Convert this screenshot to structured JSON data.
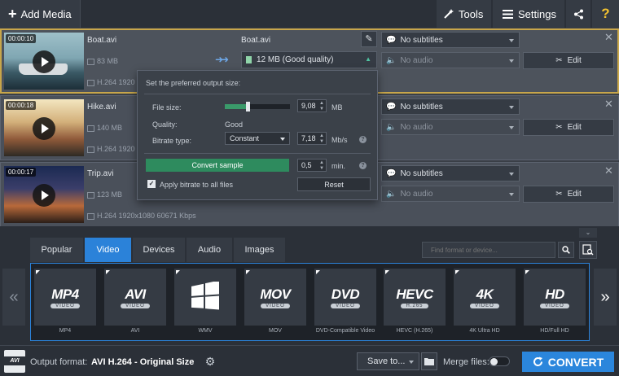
{
  "header": {
    "add_media": "Add Media",
    "tools": "Tools",
    "settings": "Settings"
  },
  "files": [
    {
      "duration": "00:00:10",
      "name": "Boat.avi",
      "output_name": "Boat.avi",
      "size": "83 MB",
      "output_size": "12 MB (Good quality)",
      "codec": "H.264 1920",
      "subtitles": "No subtitles",
      "audio": "No audio",
      "edit": "Edit"
    },
    {
      "duration": "00:00:18",
      "name": "Hike.avi",
      "size": "140 MB",
      "codec": "H.264 1920",
      "subtitles": "No subtitles",
      "audio": "No audio",
      "edit": "Edit"
    },
    {
      "duration": "00:00:17",
      "name": "Trip.avi",
      "size": "123 MB",
      "codec": "H.264 1920x1080 60671 Kbps",
      "subtitles": "No subtitles",
      "audio": "No audio",
      "edit": "Edit"
    }
  ],
  "popup": {
    "heading": "Set the preferred output size:",
    "file_size_label": "File size:",
    "file_size_value": "9,08",
    "file_size_unit": "MB",
    "file_size_fraction": 0.35,
    "quality_label": "Quality:",
    "quality_value": "Good",
    "bitrate_label": "Bitrate type:",
    "bitrate_type": "Constant",
    "bitrate_value": "7,18",
    "bitrate_unit": "Mb/s",
    "convert_sample": "Convert sample",
    "sample_value": "0,5",
    "sample_unit": "min.",
    "apply_all": "Apply bitrate to all files",
    "reset": "Reset"
  },
  "tabs": [
    "Popular",
    "Video",
    "Devices",
    "Audio",
    "Images"
  ],
  "active_tab": "Video",
  "search_placeholder": "Find format or device...",
  "formats": [
    {
      "logo": "MP4",
      "sub": "VIDEO",
      "label": "MP4"
    },
    {
      "logo": "AVI",
      "sub": "VIDEO",
      "label": "AVI"
    },
    {
      "logo": "",
      "sub": "",
      "label": "WMV"
    },
    {
      "logo": "MOV",
      "sub": "VIDEO",
      "label": "MOV"
    },
    {
      "logo": "DVD",
      "sub": "VIDEO",
      "label": "DVD-Compatible Video"
    },
    {
      "logo": "HEVC",
      "sub": "H.265",
      "label": "HEVC (H.265)"
    },
    {
      "logo": "4K",
      "sub": "VIDEO",
      "label": "4K Ultra HD"
    },
    {
      "logo": "HD",
      "sub": "VIDEO",
      "label": "HD/Full HD"
    }
  ],
  "bottom": {
    "output_label": "Output format:",
    "output_value": "AVI H.264 - Original Size",
    "save_to": "Save to...",
    "merge": "Merge files:",
    "convert": "CONVERT"
  },
  "colors": {
    "accent": "#2b82d9",
    "selection": "#c8a64a",
    "sample_button": "#2e8b5e"
  }
}
